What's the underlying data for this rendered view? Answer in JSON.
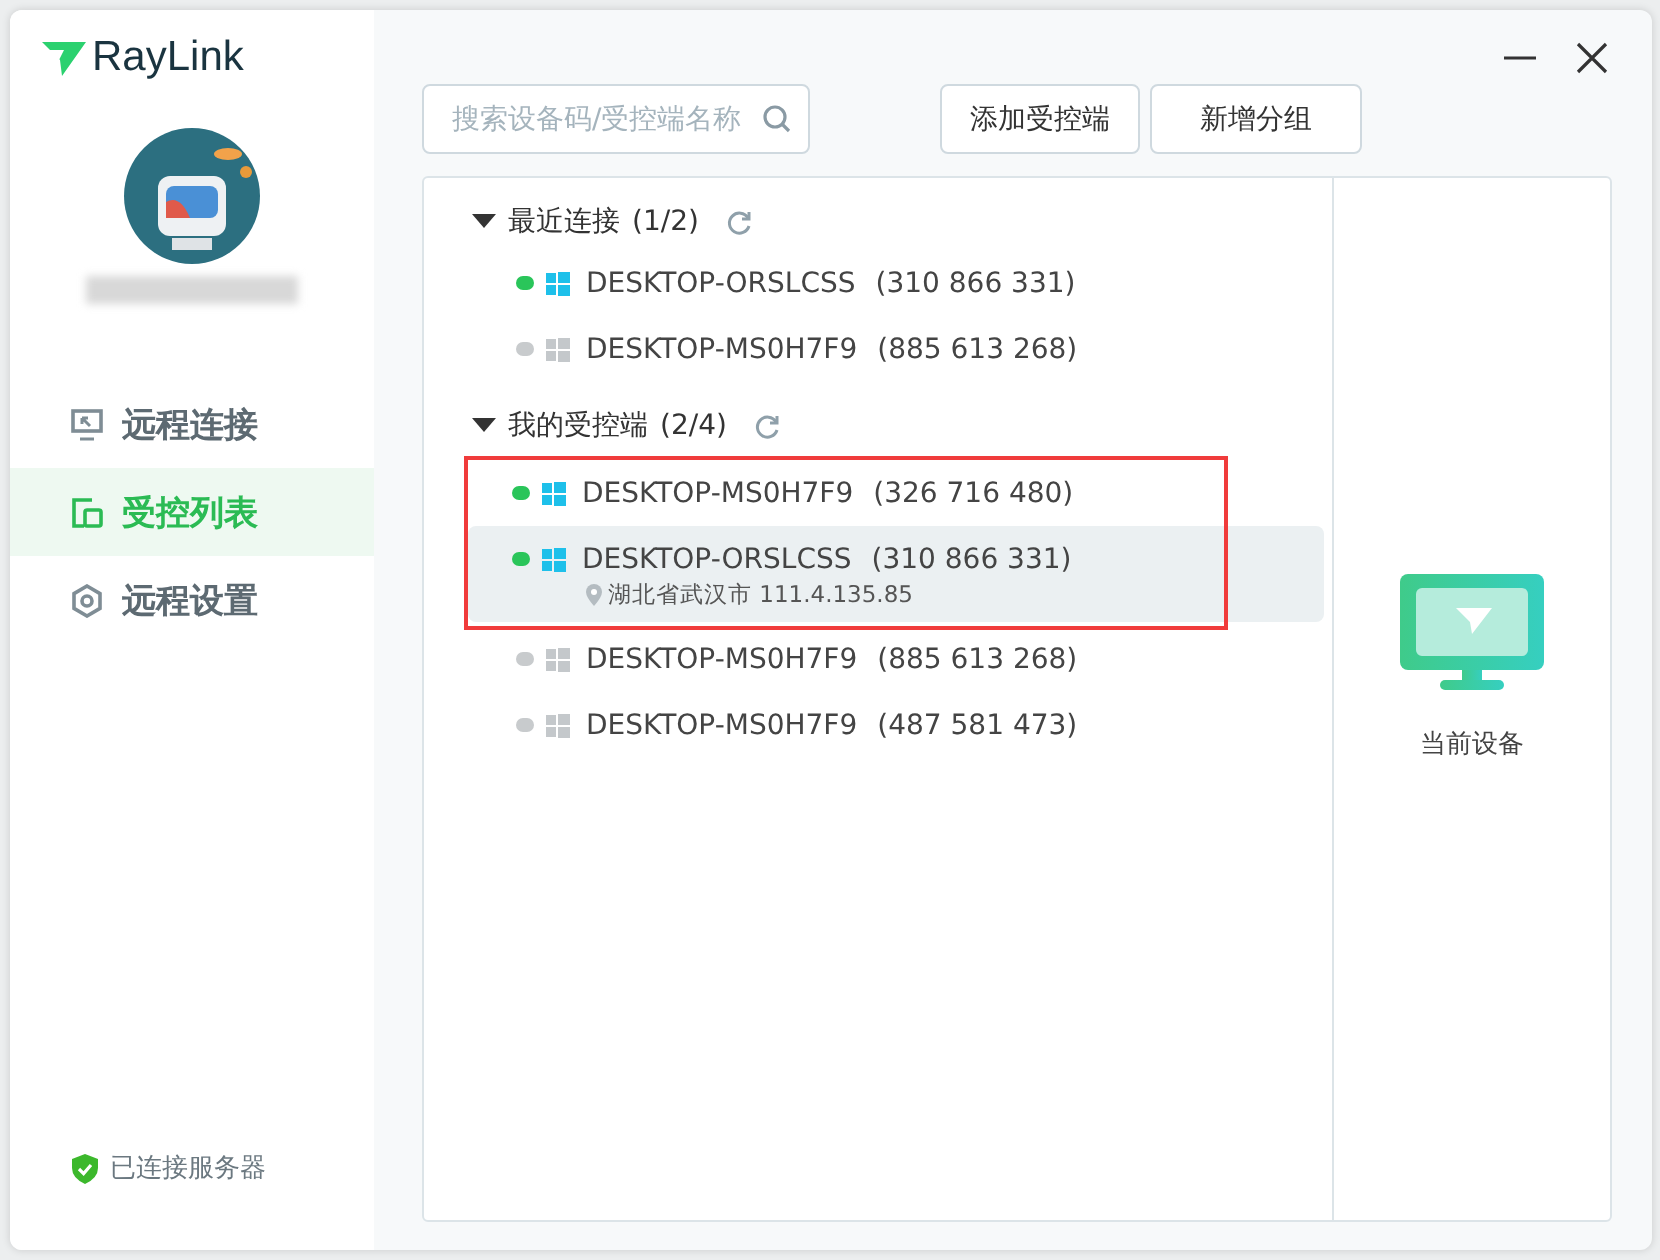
{
  "app": {
    "logo_text": "RayLink"
  },
  "sidebar": {
    "items": [
      {
        "label": "远程连接",
        "kind": "connect",
        "selected": false
      },
      {
        "label": "受控列表",
        "kind": "list",
        "selected": true
      },
      {
        "label": "远程设置",
        "kind": "settings",
        "selected": false
      }
    ],
    "status": {
      "label": "已连接服务器",
      "connected": true
    }
  },
  "toolbar": {
    "search": {
      "placeholder": "搜索设备码/受控端名称"
    },
    "buttons": [
      "添加受控端",
      "新增分组"
    ]
  },
  "groups": [
    {
      "title": "最近连接",
      "count": "(1/2)",
      "expanded": true,
      "blocks": [
        {
          "annotated": false,
          "devices": [
            {
              "name": "DESKTOP-ORSLCSS",
              "code": "(310 866 331)",
              "online": true,
              "selected": false
            },
            {
              "name": "DESKTOP-MS0H7F9",
              "code": "(885 613 268)",
              "online": false,
              "selected": false
            }
          ]
        }
      ]
    },
    {
      "title": "我的受控端",
      "count": "(2/4)",
      "expanded": true,
      "blocks": [
        {
          "annotated": true,
          "devices": [
            {
              "name": "DESKTOP-MS0H7F9",
              "code": "(326 716 480)",
              "online": true,
              "selected": false
            },
            {
              "name": "DESKTOP-ORSLCSS",
              "code": "(310 866 331)",
              "online": true,
              "selected": true,
              "location": "湖北省武汉市 111.4.135.85"
            }
          ]
        },
        {
          "annotated": false,
          "devices": [
            {
              "name": "DESKTOP-MS0H7F9",
              "code": "(885 613 268)",
              "online": false,
              "selected": false
            },
            {
              "name": "DESKTOP-MS0H7F9",
              "code": "(487 581 473)",
              "online": false,
              "selected": false
            }
          ]
        }
      ]
    }
  ],
  "current_device": {
    "label": "当前设备"
  }
}
